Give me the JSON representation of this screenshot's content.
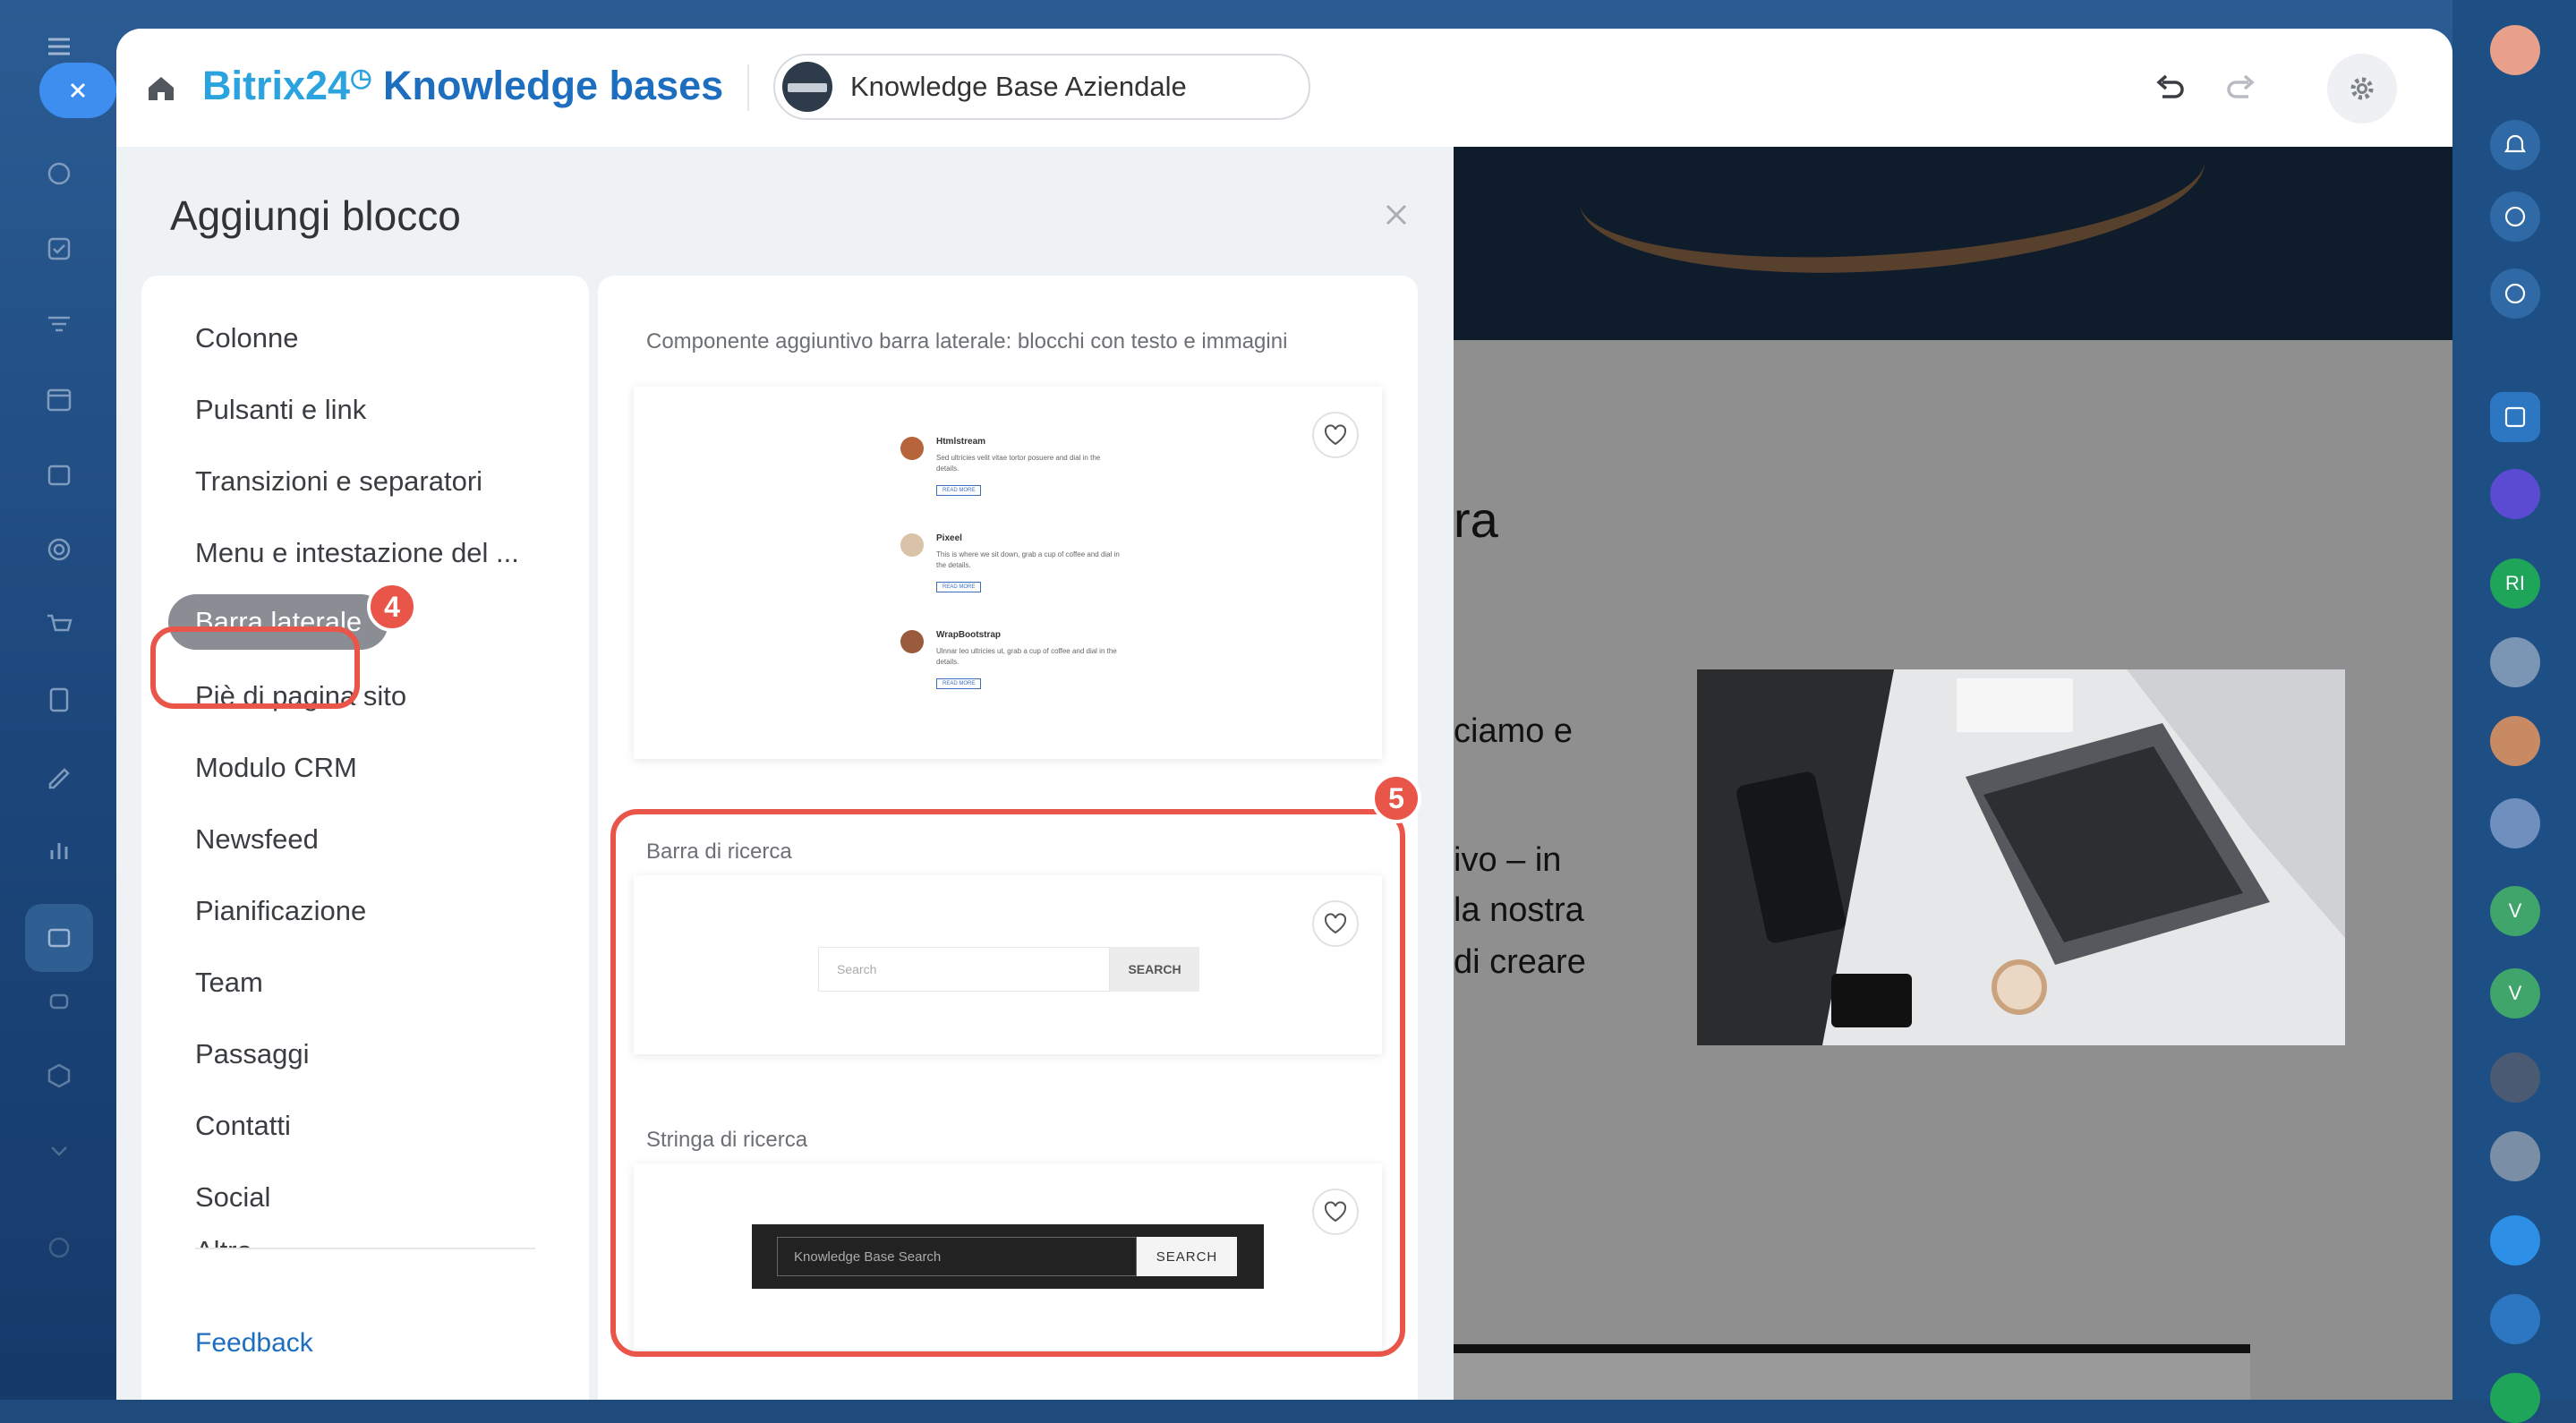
{
  "header": {
    "brand_prefix": "Bitrix24",
    "brand_suffix": "Knowledge bases",
    "kb_selector": "Knowledge Base Aziendale"
  },
  "panel": {
    "title": "Aggiungi blocco",
    "categories": [
      "Colonne",
      "Pulsanti e link",
      "Transizioni e separatori",
      "Menu e intestazione del ...",
      "Barra laterale",
      "Piè di pagina sito",
      "Modulo CRM",
      "Newsfeed",
      "Pianificazione",
      "Team",
      "Passaggi",
      "Contatti",
      "Social",
      "Altro"
    ],
    "active_category": "Barra laterale",
    "feedback": "Feedback"
  },
  "blocks": [
    {
      "title": "Componente aggiuntivo barra laterale: blocchi con testo e immagini",
      "items": [
        {
          "name": "Htmlstream",
          "text": "Sed ultricies velit vitae tortor posuere and dial in the details.",
          "button": "READ MORE"
        },
        {
          "name": "Pixeel",
          "text": "This is where we sit down, grab a cup of coffee and dial in the details.",
          "button": "READ MORE"
        },
        {
          "name": "WrapBootstrap",
          "text": "Ulnnar leo ultricies ut, grab a cup of coffee and dial in the details.",
          "button": "READ MORE"
        }
      ]
    },
    {
      "title": "Barra di ricerca",
      "placeholder": "Search",
      "button": "SEARCH"
    },
    {
      "title": "Stringa di ricerca",
      "placeholder": "Knowledge Base Search",
      "button": "SEARCH"
    }
  ],
  "annotations": {
    "badge_category": "4",
    "badge_blocks": "5",
    "color": "#ea5549"
  },
  "preview": {
    "title_fragment": "ra",
    "lines": [
      "ciamo e",
      "ivo – in",
      "la nostra",
      "di creare"
    ]
  },
  "right_rail": {
    "avatar_initials_1": "RI",
    "avatar_initials_2": "V",
    "avatar_initials_3": "V"
  }
}
